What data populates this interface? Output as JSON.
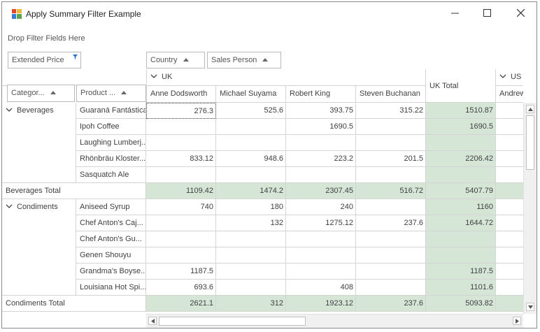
{
  "window": {
    "title": "Apply Summary Filter Example",
    "controls": [
      "minimize",
      "maximize",
      "close"
    ]
  },
  "filter_area": {
    "hint": "Drop Filter Fields Here",
    "data_field": "Extended Price",
    "column_fields": [
      "Country",
      "Sales Person"
    ],
    "row_fields": [
      "Categor...",
      "Product ..."
    ]
  },
  "grid": {
    "country_headers": [
      "UK",
      "US"
    ],
    "sales_persons": [
      "Anne Dodsworth",
      "Michael Suyama",
      "Robert King",
      "Steven Buchanan"
    ],
    "uk_total_label": "UK Total",
    "next_person_partial": "Andrew",
    "groups": [
      {
        "category": "Beverages",
        "total_label": "Beverages Total",
        "rows": [
          {
            "product": "Guaraná Fantástica",
            "values": [
              "276.3",
              "525.6",
              "393.75",
              "315.22"
            ],
            "total": "1510.87"
          },
          {
            "product": "Ipoh Coffee",
            "values": [
              "",
              "",
              "1690.5",
              ""
            ],
            "total": "1690.5"
          },
          {
            "product": "Laughing Lumberj...",
            "values": [
              "",
              "",
              "",
              ""
            ],
            "total": ""
          },
          {
            "product": "Rhönbräu Kloster...",
            "values": [
              "833.12",
              "948.6",
              "223.2",
              "201.5"
            ],
            "total": "2206.42"
          },
          {
            "product": "Sasquatch Ale",
            "values": [
              "",
              "",
              "",
              ""
            ],
            "total": ""
          }
        ],
        "totals": [
          "1109.42",
          "1474.2",
          "2307.45",
          "516.72"
        ],
        "grand": "5407.79"
      },
      {
        "category": "Condiments",
        "total_label": "Condiments Total",
        "rows": [
          {
            "product": "Aniseed Syrup",
            "values": [
              "740",
              "180",
              "240",
              ""
            ],
            "total": "1160"
          },
          {
            "product": "Chef Anton's Caj...",
            "values": [
              "",
              "132",
              "1275.12",
              "237.6"
            ],
            "total": "1644.72"
          },
          {
            "product": "Chef Anton's Gu...",
            "values": [
              "",
              "",
              "",
              ""
            ],
            "total": ""
          },
          {
            "product": "Genen Shouyu",
            "values": [
              "",
              "",
              "",
              ""
            ],
            "total": ""
          },
          {
            "product": "Grandma's Boyse...",
            "values": [
              "1187.5",
              "",
              "",
              ""
            ],
            "total": "1187.5"
          },
          {
            "product": "Louisiana Hot Spi...",
            "values": [
              "693.6",
              "",
              "408",
              ""
            ],
            "total": "1101.6"
          }
        ],
        "totals": [
          "2621.1",
          "312",
          "1923.12",
          "237.6"
        ],
        "grand": "5093.82"
      }
    ]
  },
  "colors": {
    "total_fill": "#d5e6d7",
    "grid_line": "#d4d4d4",
    "text": "#404040"
  }
}
